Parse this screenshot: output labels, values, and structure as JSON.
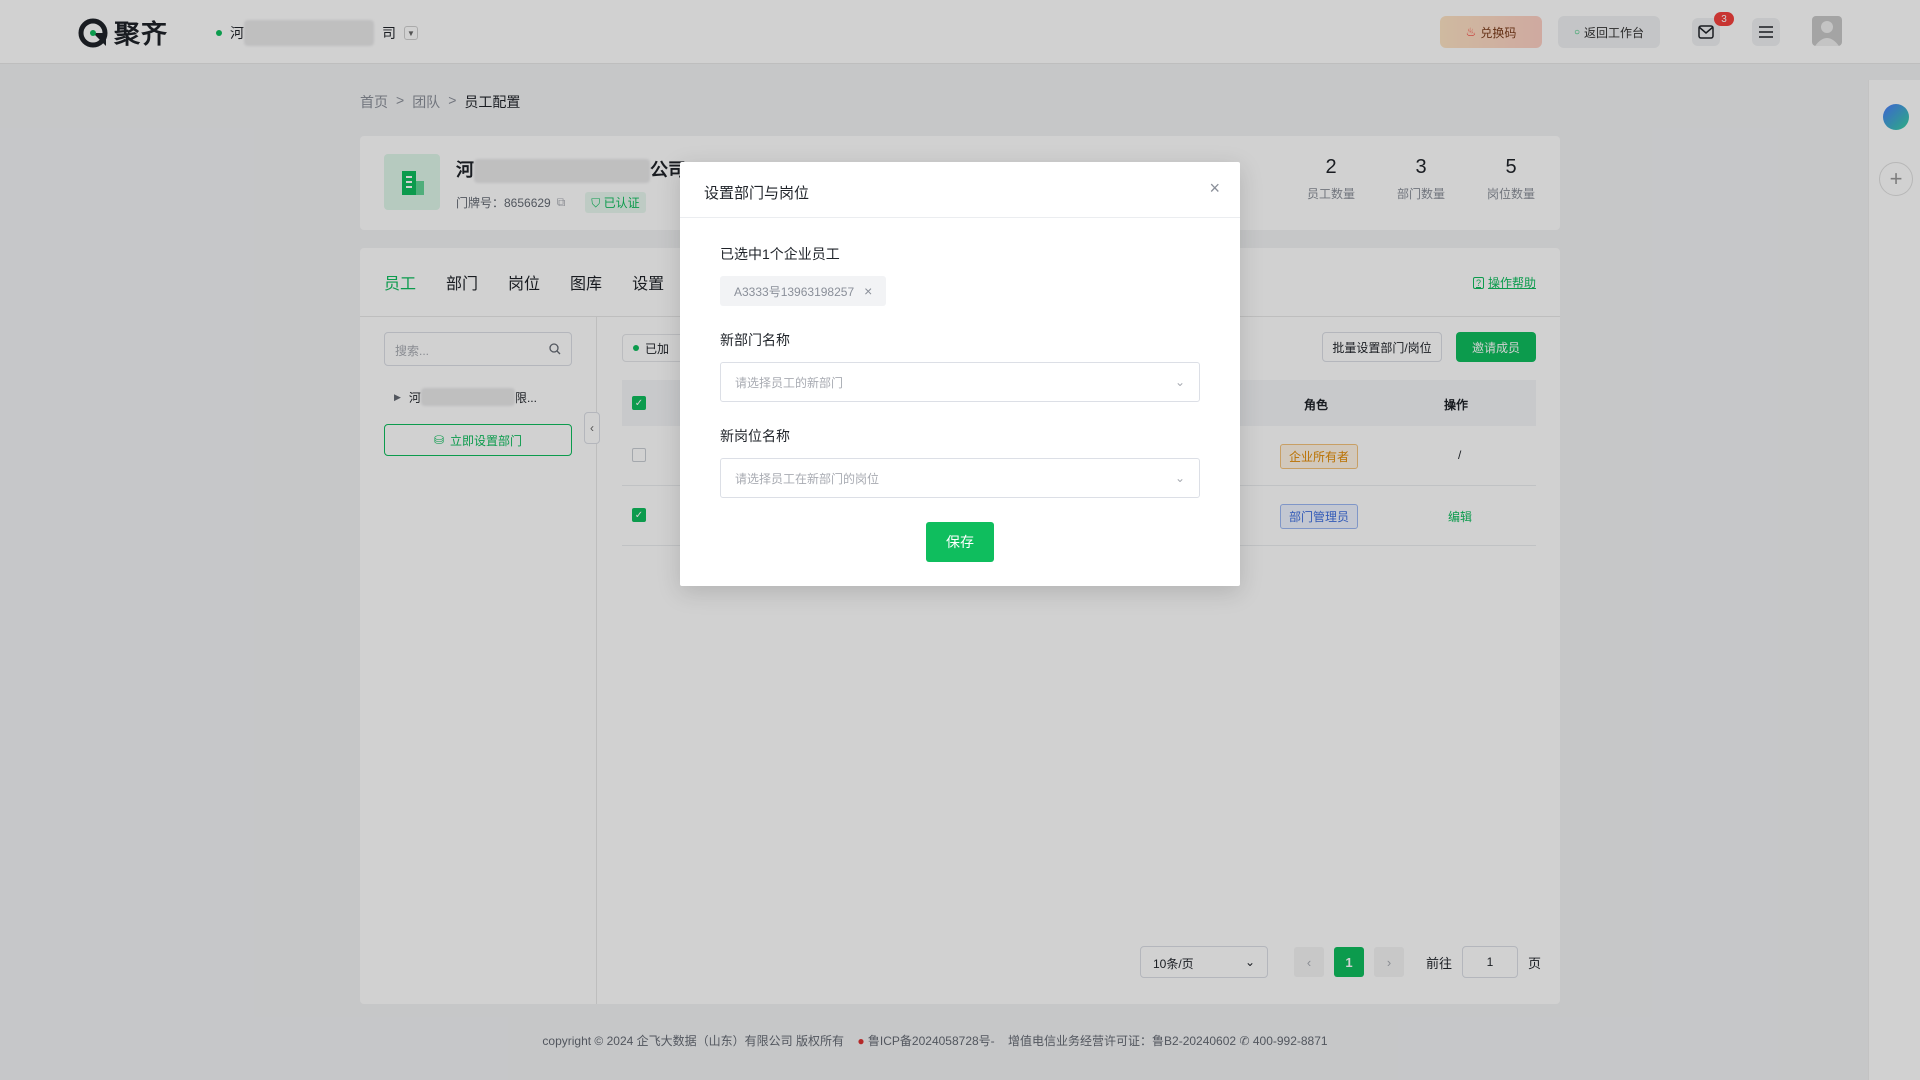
{
  "header": {
    "logo_text": "聚齐",
    "company_prefix": "河",
    "company_suffix": "司",
    "redeem_label": "兑换码",
    "back_label": "返回工作台",
    "mail_badge": "3"
  },
  "breadcrumb": {
    "home": "首页",
    "team": "团队",
    "current": "员工配置",
    "sep": ">"
  },
  "company": {
    "name_prefix": "河",
    "name_suffix": "公司",
    "door_label": "门牌号：8656629",
    "verified_label": "已认证",
    "stats": [
      {
        "num": "2",
        "label": "员工数量"
      },
      {
        "num": "3",
        "label": "部门数量"
      },
      {
        "num": "5",
        "label": "岗位数量"
      }
    ]
  },
  "tabs": [
    "员工",
    "部门",
    "岗位",
    "图库",
    "设置"
  ],
  "help_label": "操作帮助",
  "sidebar": {
    "search_placeholder": "搜索...",
    "tree_prefix": "河",
    "tree_suffix": "限...",
    "setup_button": "立即设置部门"
  },
  "table": {
    "filter_label": "已加",
    "batch_button": "批量设置部门/岗位",
    "invite_button": "邀请成员",
    "col_role": "角色",
    "col_op": "操作",
    "rows": [
      {
        "role": "企业所有者",
        "op": "/"
      },
      {
        "role": "部门管理员",
        "op": "编辑"
      }
    ]
  },
  "pagination": {
    "page_size": "10条/页",
    "current": "1",
    "goto_label": "前往",
    "goto_value": "1",
    "page_unit": "页"
  },
  "footer": {
    "text": "copyright © 2024 企飞大数据（山东）有限公司 版权所有",
    "icp": "鲁ICP备2024058728号-",
    "license": "增值电信业务经营许可证：鲁B2-20240602",
    "phone": "400-992-8871"
  },
  "modal": {
    "title": "设置部门与岗位",
    "selected_label": "已选中1个企业员工",
    "chip_text": "A3333号13963198257",
    "dept_label": "新部门名称",
    "dept_placeholder": "请选择员工的新部门",
    "post_label": "新岗位名称",
    "post_placeholder": "请选择员工在新部门的岗位",
    "save_button": "保存"
  },
  "colors": {
    "brand": "#0fbe5e",
    "owner_tag": "#e38a00",
    "admin_tag": "#3f6fe0"
  }
}
